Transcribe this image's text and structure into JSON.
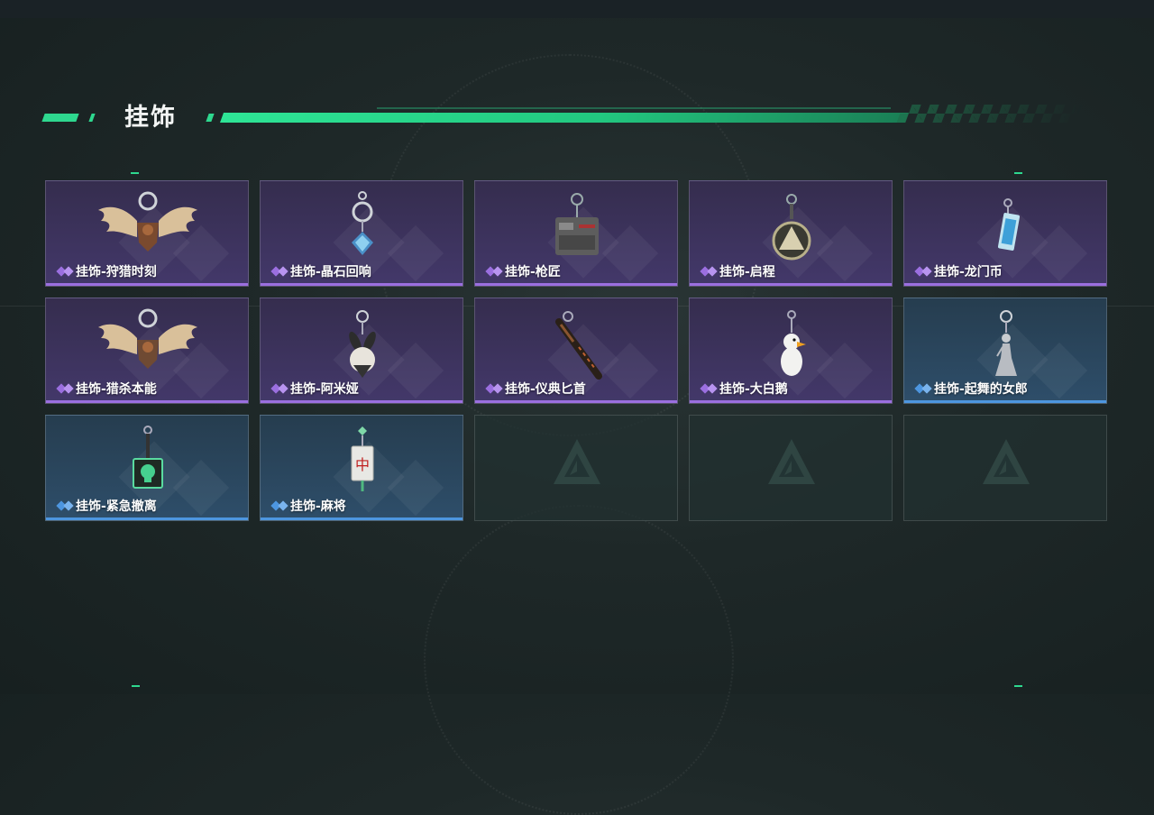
{
  "section": {
    "title": "挂饰"
  },
  "colors": {
    "accent_green": "#2ed88f",
    "rarity_epic": "#9b6fe0",
    "rarity_rare": "#4d96e0"
  },
  "items": [
    {
      "label": "挂饰-狩猎时刻",
      "rarity": "epic",
      "icon": "moose-antler-charm-icon"
    },
    {
      "label": "挂饰-晶石回响",
      "rarity": "epic",
      "icon": "crystal-ring-charm-icon"
    },
    {
      "label": "挂饰-枪匠",
      "rarity": "epic",
      "icon": "gun-part-charm-icon"
    },
    {
      "label": "挂饰-启程",
      "rarity": "epic",
      "icon": "round-emblem-charm-icon"
    },
    {
      "label": "挂饰-龙门币",
      "rarity": "epic",
      "icon": "card-charm-icon"
    },
    {
      "label": "挂饰-猎杀本能",
      "rarity": "epic",
      "icon": "moose-antler-charm-icon"
    },
    {
      "label": "挂饰-阿米娅",
      "rarity": "epic",
      "icon": "bunny-charm-icon"
    },
    {
      "label": "挂饰-仪典匕首",
      "rarity": "epic",
      "icon": "dagger-charm-icon"
    },
    {
      "label": "挂饰-大白鹅",
      "rarity": "epic",
      "icon": "goose-charm-icon"
    },
    {
      "label": "挂饰-起舞的女郎",
      "rarity": "rare",
      "icon": "dancer-figurine-charm-icon"
    },
    {
      "label": "挂饰-紧急撤离",
      "rarity": "rare",
      "icon": "skull-box-charm-icon"
    },
    {
      "label": "挂饰-麻将",
      "rarity": "rare",
      "icon": "mahjong-tile-charm-icon"
    },
    {
      "label": "",
      "rarity": "empty",
      "icon": "empty-slot-logo-icon"
    },
    {
      "label": "",
      "rarity": "empty",
      "icon": "empty-slot-logo-icon"
    },
    {
      "label": "",
      "rarity": "empty",
      "icon": "empty-slot-logo-icon"
    }
  ],
  "mahjong_glyph": "中"
}
